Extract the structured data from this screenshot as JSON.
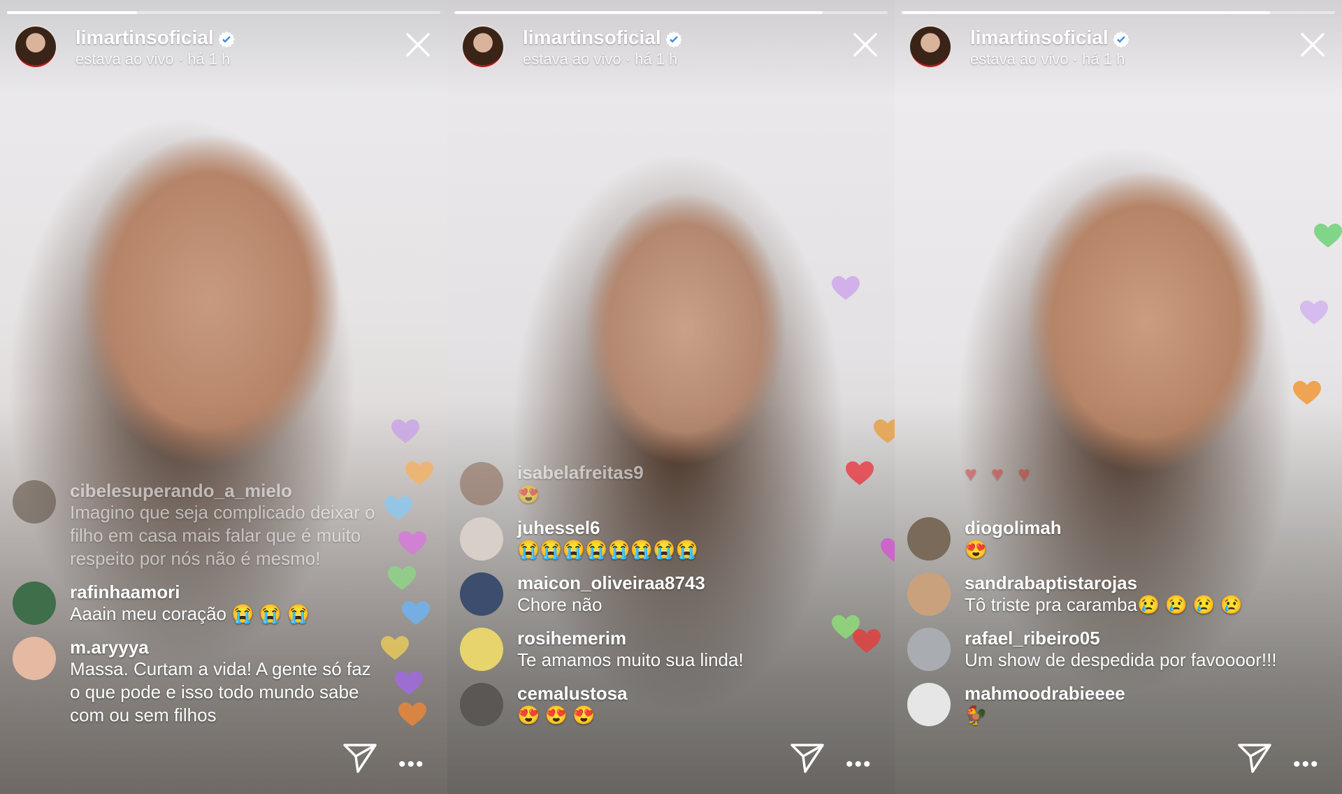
{
  "colors": {
    "progress_track": "#ffffff73",
    "progress_fill": "#ffffff",
    "text": "#ffffff"
  },
  "icons": {
    "verified": "verified-badge-icon",
    "close": "close-icon",
    "send": "send-icon",
    "more": "more-icon"
  },
  "panels": [
    {
      "progress": 0.3,
      "username": "limartinsoficial",
      "status": "estava ao vivo · há 1 h",
      "comments": [
        {
          "user": "cibelesuperando_a_mielo",
          "text": "Imagino que seja complicado deixar o filho em casa mais falar que é muito respeito por nós não é mesmo!",
          "avatar_color": "#5a4a3d"
        },
        {
          "user": "rafinhaamori",
          "text": "Aaain meu coração 😭 😭 😭",
          "avatar_color": "#3f6e4a"
        },
        {
          "user": "m.aryyya",
          "text": "Massa. Curtam a vida! A gente só faz o que pode e isso todo mundo sabe com ou sem filhos",
          "avatar_color": "#e6b9a2"
        }
      ],
      "hearts": [
        "#c9a6e6",
        "#f2b36a",
        "#8fc8ee",
        "#d77ad9",
        "#8fd488",
        "#6fb3f0",
        "#e6c95c",
        "#a16be0",
        "#e8873a"
      ]
    },
    {
      "progress": 0.85,
      "username": "limartinsoficial",
      "status": "estava ao vivo · há 1 h",
      "comments": [
        {
          "user": "isabelafreitas9",
          "text": "😍",
          "avatar_color": "#8a6552"
        },
        {
          "user": "juhessel6",
          "text": "😭😭😭😭😭😭😭😭",
          "avatar_color": "#d8cfc8"
        },
        {
          "user": "maicon_oliveiraa8743",
          "text": "Chore não",
          "avatar_color": "#3d4d6d"
        },
        {
          "user": "rosihemerim",
          "text": "Te amamos muito sua linda!",
          "avatar_color": "#e7d46c"
        },
        {
          "user": "cemalustosa",
          "text": "😍 😍 😍",
          "avatar_color": "#5b5754"
        }
      ],
      "hearts": [
        "#cfa8ea",
        "#e8a24a",
        "#e8424a",
        "#d25ad0",
        "#8fdc7a",
        "#e0413f"
      ]
    },
    {
      "progress": 0.85,
      "username": "limartinsoficial",
      "status": "estava ao vivo · há 1 h",
      "comments": [
        {
          "user": "diogolimah",
          "text": "😍",
          "avatar_color": "#7a6a5a"
        },
        {
          "user": "sandrabaptistarojas",
          "text": "Tô triste pra caramba😢 😢 😢 😢",
          "avatar_color": "#c9a27d"
        },
        {
          "user": "rafael_ribeiro05",
          "text": "Um show de despedida por favoooor!!!",
          "avatar_color": "#a9adb2"
        },
        {
          "user": "mahmoodrabieeee",
          "text": "🐓",
          "avatar_color": "#e6e6e6"
        }
      ],
      "top_hearts": "♥ ♥ ♥",
      "hearts": [
        "#6fd278",
        "#d3b4f0",
        "#f09a3a"
      ]
    }
  ]
}
